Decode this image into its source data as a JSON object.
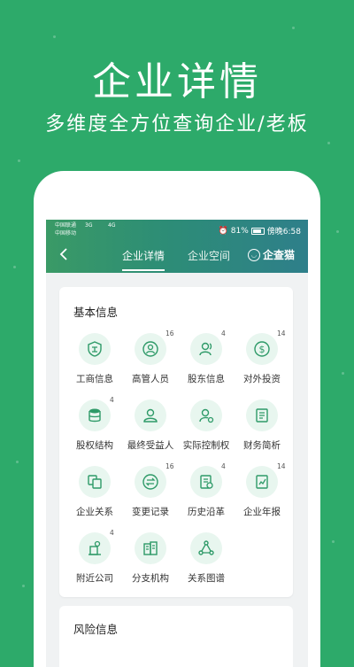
{
  "hero": {
    "title": "企业详情",
    "subtitle": "多维度全方位查询企业/老板"
  },
  "status_bar": {
    "carrier_line1": "中国联通",
    "carrier_line2": "中国移动",
    "signal1": "3G",
    "signal2": "4G",
    "battery": "81%",
    "time": "傍晚6:58"
  },
  "nav": {
    "tabs": [
      {
        "label": "企业详情",
        "active": true
      },
      {
        "label": "企业空间",
        "active": false
      }
    ],
    "brand": "企查猫"
  },
  "basic_info": {
    "title": "基本信息",
    "items": [
      {
        "label": "工商信息",
        "icon": "shield-icon",
        "badge": ""
      },
      {
        "label": "高管人员",
        "icon": "person-circle-icon",
        "badge": "16"
      },
      {
        "label": "股东信息",
        "icon": "shareholder-icon",
        "badge": "4"
      },
      {
        "label": "对外投资",
        "icon": "dollar-circle-icon",
        "badge": "14"
      },
      {
        "label": "股权结构",
        "icon": "database-icon",
        "badge": "4"
      },
      {
        "label": "最终受益人",
        "icon": "user-icon",
        "badge": ""
      },
      {
        "label": "实际控制权",
        "icon": "user-gear-icon",
        "badge": ""
      },
      {
        "label": "财务简析",
        "icon": "report-icon",
        "badge": ""
      },
      {
        "label": "企业关系",
        "icon": "copy-icon",
        "badge": ""
      },
      {
        "label": "变更记录",
        "icon": "swap-icon",
        "badge": "16"
      },
      {
        "label": "历史沿革",
        "icon": "history-doc-icon",
        "badge": "4"
      },
      {
        "label": "企业年报",
        "icon": "annual-report-icon",
        "badge": "14"
      },
      {
        "label": "附近公司",
        "icon": "map-building-icon",
        "badge": "4"
      },
      {
        "label": "分支机构",
        "icon": "buildings-icon",
        "badge": ""
      },
      {
        "label": "关系图谱",
        "icon": "graph-icon",
        "badge": ""
      }
    ]
  },
  "risk_info": {
    "title": "风险信息"
  },
  "colors": {
    "background": "#2daa6a",
    "accent": "#2e9a68",
    "icon_bg": "#e8f6ef"
  }
}
